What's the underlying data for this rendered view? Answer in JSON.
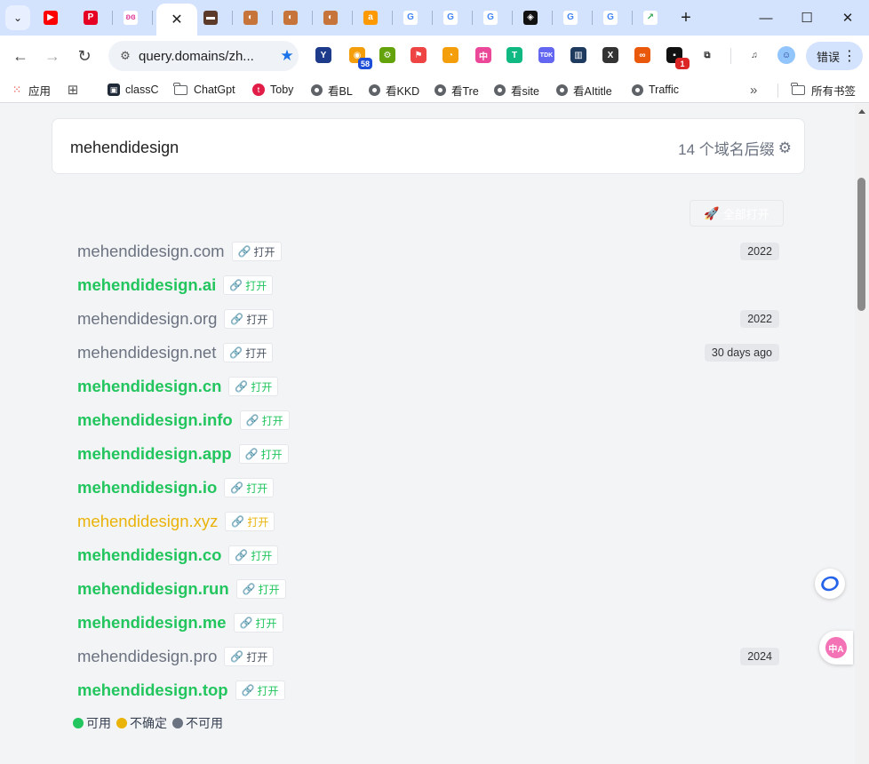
{
  "browser": {
    "tabs": [
      {
        "icon": "youtube-icon",
        "glyph": "▶",
        "bg": "#ff0000"
      },
      {
        "icon": "pinterest-icon",
        "glyph": "P",
        "bg": "#e60023"
      },
      {
        "icon": "butterfly-icon",
        "glyph": "ʚɞ",
        "bg": "#ffffff",
        "fg": "#e0449c"
      },
      {
        "icon": "close-icon",
        "glyph": "✕",
        "active": true
      },
      {
        "icon": "brown-site-icon",
        "glyph": "▬",
        "bg": "#5b3a29"
      },
      {
        "icon": "cookie-icon",
        "glyph": "◐",
        "bg": "#c7743a"
      },
      {
        "icon": "cookie-icon",
        "glyph": "◐",
        "bg": "#c7743a"
      },
      {
        "icon": "cookie-icon",
        "glyph": "◐",
        "bg": "#c7743a"
      },
      {
        "icon": "amazon-a-icon",
        "glyph": "a",
        "bg": "#ff9900"
      },
      {
        "icon": "google-icon",
        "glyph": "G",
        "bg": "#ffffff",
        "fg": "#4285f4"
      },
      {
        "icon": "google-icon",
        "glyph": "G",
        "bg": "#ffffff",
        "fg": "#4285f4"
      },
      {
        "icon": "google-icon",
        "glyph": "G",
        "bg": "#ffffff",
        "fg": "#4285f4"
      },
      {
        "icon": "dark-square-icon",
        "glyph": "◈",
        "bg": "#111111"
      },
      {
        "icon": "google-icon",
        "glyph": "G",
        "bg": "#ffffff",
        "fg": "#4285f4"
      },
      {
        "icon": "google-icon",
        "glyph": "G",
        "bg": "#ffffff",
        "fg": "#4285f4"
      },
      {
        "icon": "trend-icon",
        "glyph": "↗",
        "bg": "#ffffff",
        "fg": "#34a853"
      }
    ],
    "url": "query.domains/zh...",
    "extensions": [
      {
        "icon": "y-extension-icon",
        "glyph": "Y",
        "bg": "#1e3a8a"
      },
      {
        "icon": "rss-extension-icon",
        "glyph": "◉",
        "bg": "#f59e0b",
        "badge": "58",
        "badge_bg": "#1d4ed8"
      },
      {
        "icon": "puzzle-gear-extension-icon",
        "glyph": "⚙",
        "bg": "#65a30d"
      },
      {
        "icon": "red-flag-extension-icon",
        "glyph": "⚑",
        "bg": "#ef4444"
      },
      {
        "icon": "speedometer-extension-icon",
        "glyph": "◔",
        "bg": "#f59e0b"
      },
      {
        "icon": "translate-extension-icon",
        "glyph": "中",
        "bg": "#ec4899"
      },
      {
        "icon": "t-extension-icon",
        "glyph": "T",
        "bg": "#10b981"
      },
      {
        "icon": "tdk-extension-icon",
        "glyph": "TDK",
        "bg": "#6366f1"
      },
      {
        "icon": "books-extension-icon",
        "glyph": "▥",
        "bg": "#1e3a5f"
      },
      {
        "icon": "x-extension-icon",
        "glyph": "X",
        "bg": "#333333"
      },
      {
        "icon": "link-extension-icon",
        "glyph": "∞",
        "bg": "#ea580c"
      },
      {
        "icon": "chat-extension-icon",
        "glyph": "▪",
        "bg": "#111111",
        "badge": "1",
        "badge_bg": "#dc2626"
      },
      {
        "icon": "extensions-puzzle-icon",
        "glyph": "⧉",
        "bg": "#ffffff",
        "fg": "#333333"
      },
      {
        "icon": "media-control-icon",
        "glyph": "♫",
        "bg": "#ffffff",
        "fg": "#333333"
      },
      {
        "icon": "profile-avatar-icon",
        "glyph": "☺",
        "bg": "#93c5fd",
        "fg": "#1e3a8a"
      }
    ],
    "error_button": "错误",
    "bookmarks": {
      "apps": "应用",
      "items": [
        {
          "label": "classC",
          "icon": "classc-icon"
        },
        {
          "label": "ChatGpt",
          "icon": "folder-icon"
        },
        {
          "label": "Toby",
          "icon": "toby-icon"
        },
        {
          "label": "看BL",
          "icon": "globe-icon"
        },
        {
          "label": "看KKD",
          "icon": "globe-icon"
        },
        {
          "label": "看Tre",
          "icon": "globe-icon"
        },
        {
          "label": "看site",
          "icon": "globe-icon"
        },
        {
          "label": "看AItitle",
          "icon": "globe-icon"
        },
        {
          "label": "Traffic",
          "icon": "globe-icon"
        }
      ],
      "all_bookmarks": "所有书签"
    }
  },
  "search": {
    "query": "mehendidesign",
    "suffix_count": "14 个域名后缀"
  },
  "open_all": "全部打开",
  "domains": [
    {
      "name": "mehendidesign.com",
      "status": "taken",
      "open": "打开",
      "year": "2022"
    },
    {
      "name": "mehendidesign.ai",
      "status": "available",
      "open": "打开",
      "year": ""
    },
    {
      "name": "mehendidesign.org",
      "status": "taken",
      "open": "打开",
      "year": "2022"
    },
    {
      "name": "mehendidesign.net",
      "status": "taken",
      "open": "打开",
      "year": "30 days ago"
    },
    {
      "name": "mehendidesign.cn",
      "status": "available",
      "open": "打开",
      "year": ""
    },
    {
      "name": "mehendidesign.info",
      "status": "available",
      "open": "打开",
      "year": ""
    },
    {
      "name": "mehendidesign.app",
      "status": "available",
      "open": "打开",
      "year": ""
    },
    {
      "name": "mehendidesign.io",
      "status": "available",
      "open": "打开",
      "year": ""
    },
    {
      "name": "mehendidesign.xyz",
      "status": "unsure",
      "open": "打开",
      "year": ""
    },
    {
      "name": "mehendidesign.co",
      "status": "available",
      "open": "打开",
      "year": ""
    },
    {
      "name": "mehendidesign.run",
      "status": "available",
      "open": "打开",
      "year": ""
    },
    {
      "name": "mehendidesign.me",
      "status": "available",
      "open": "打开",
      "year": ""
    },
    {
      "name": "mehendidesign.pro",
      "status": "taken",
      "open": "打开",
      "year": "2024"
    },
    {
      "name": "mehendidesign.top",
      "status": "available",
      "open": "打开",
      "year": ""
    }
  ],
  "legend": [
    {
      "label": "可用",
      "color": "#22c55e"
    },
    {
      "label": "不确定",
      "color": "#eab308"
    },
    {
      "label": "不可用",
      "color": "#6b7280"
    }
  ]
}
